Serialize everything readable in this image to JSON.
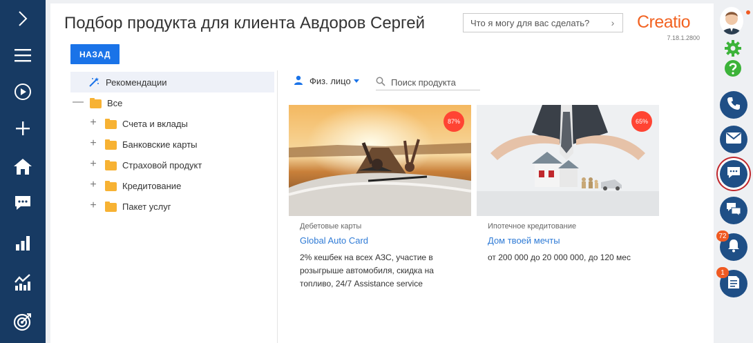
{
  "page": {
    "title": "Подбор продукта для клиента Авдоров Сергей",
    "command_placeholder": "Что я могу для вас сделать?",
    "logo_text": "Creatio",
    "version": "7.18.1.2800",
    "back_label": "НАЗАД"
  },
  "tree": {
    "items": [
      {
        "label": "Рекомендации",
        "icon": "magic-wand-icon",
        "toggle": ""
      },
      {
        "label": "Все",
        "icon": "folder-icon",
        "toggle": "—"
      },
      {
        "label": "Счета и вклады",
        "icon": "folder-icon",
        "toggle": "+"
      },
      {
        "label": "Банковские карты",
        "icon": "folder-icon",
        "toggle": "+"
      },
      {
        "label": "Страховой продукт",
        "icon": "folder-icon",
        "toggle": "+"
      },
      {
        "label": "Кредитование",
        "icon": "folder-icon",
        "toggle": "+"
      },
      {
        "label": "Пакет услуг",
        "icon": "folder-icon",
        "toggle": "+"
      }
    ]
  },
  "filters": {
    "client_type": "Физ. лицо",
    "search_placeholder": "Поиск продукта"
  },
  "products": [
    {
      "badge": "87%",
      "category": "Дебетовые карты",
      "name": "Global Auto Card",
      "description": "2% кешбек на всех АЗС, участие в розыгрыше автомобиля, скидка на топливо, 24/7 Assistance service",
      "image": "convertible-car-sunset-photo"
    },
    {
      "badge": "65%",
      "category": "Ипотечное кредитование",
      "name": "Дом твоей мечты",
      "description": "от 200 000 до 20 000 000, до 120 мес",
      "image": "hands-over-house-photo"
    }
  ],
  "rightbar": {
    "notifications_count": "72",
    "tasks_count": "1"
  },
  "colors": {
    "nav_bg": "#173a63",
    "accent": "#1a73e8",
    "brand": "#f26322",
    "badge": "#ff4433",
    "link": "#2f7bd6"
  }
}
